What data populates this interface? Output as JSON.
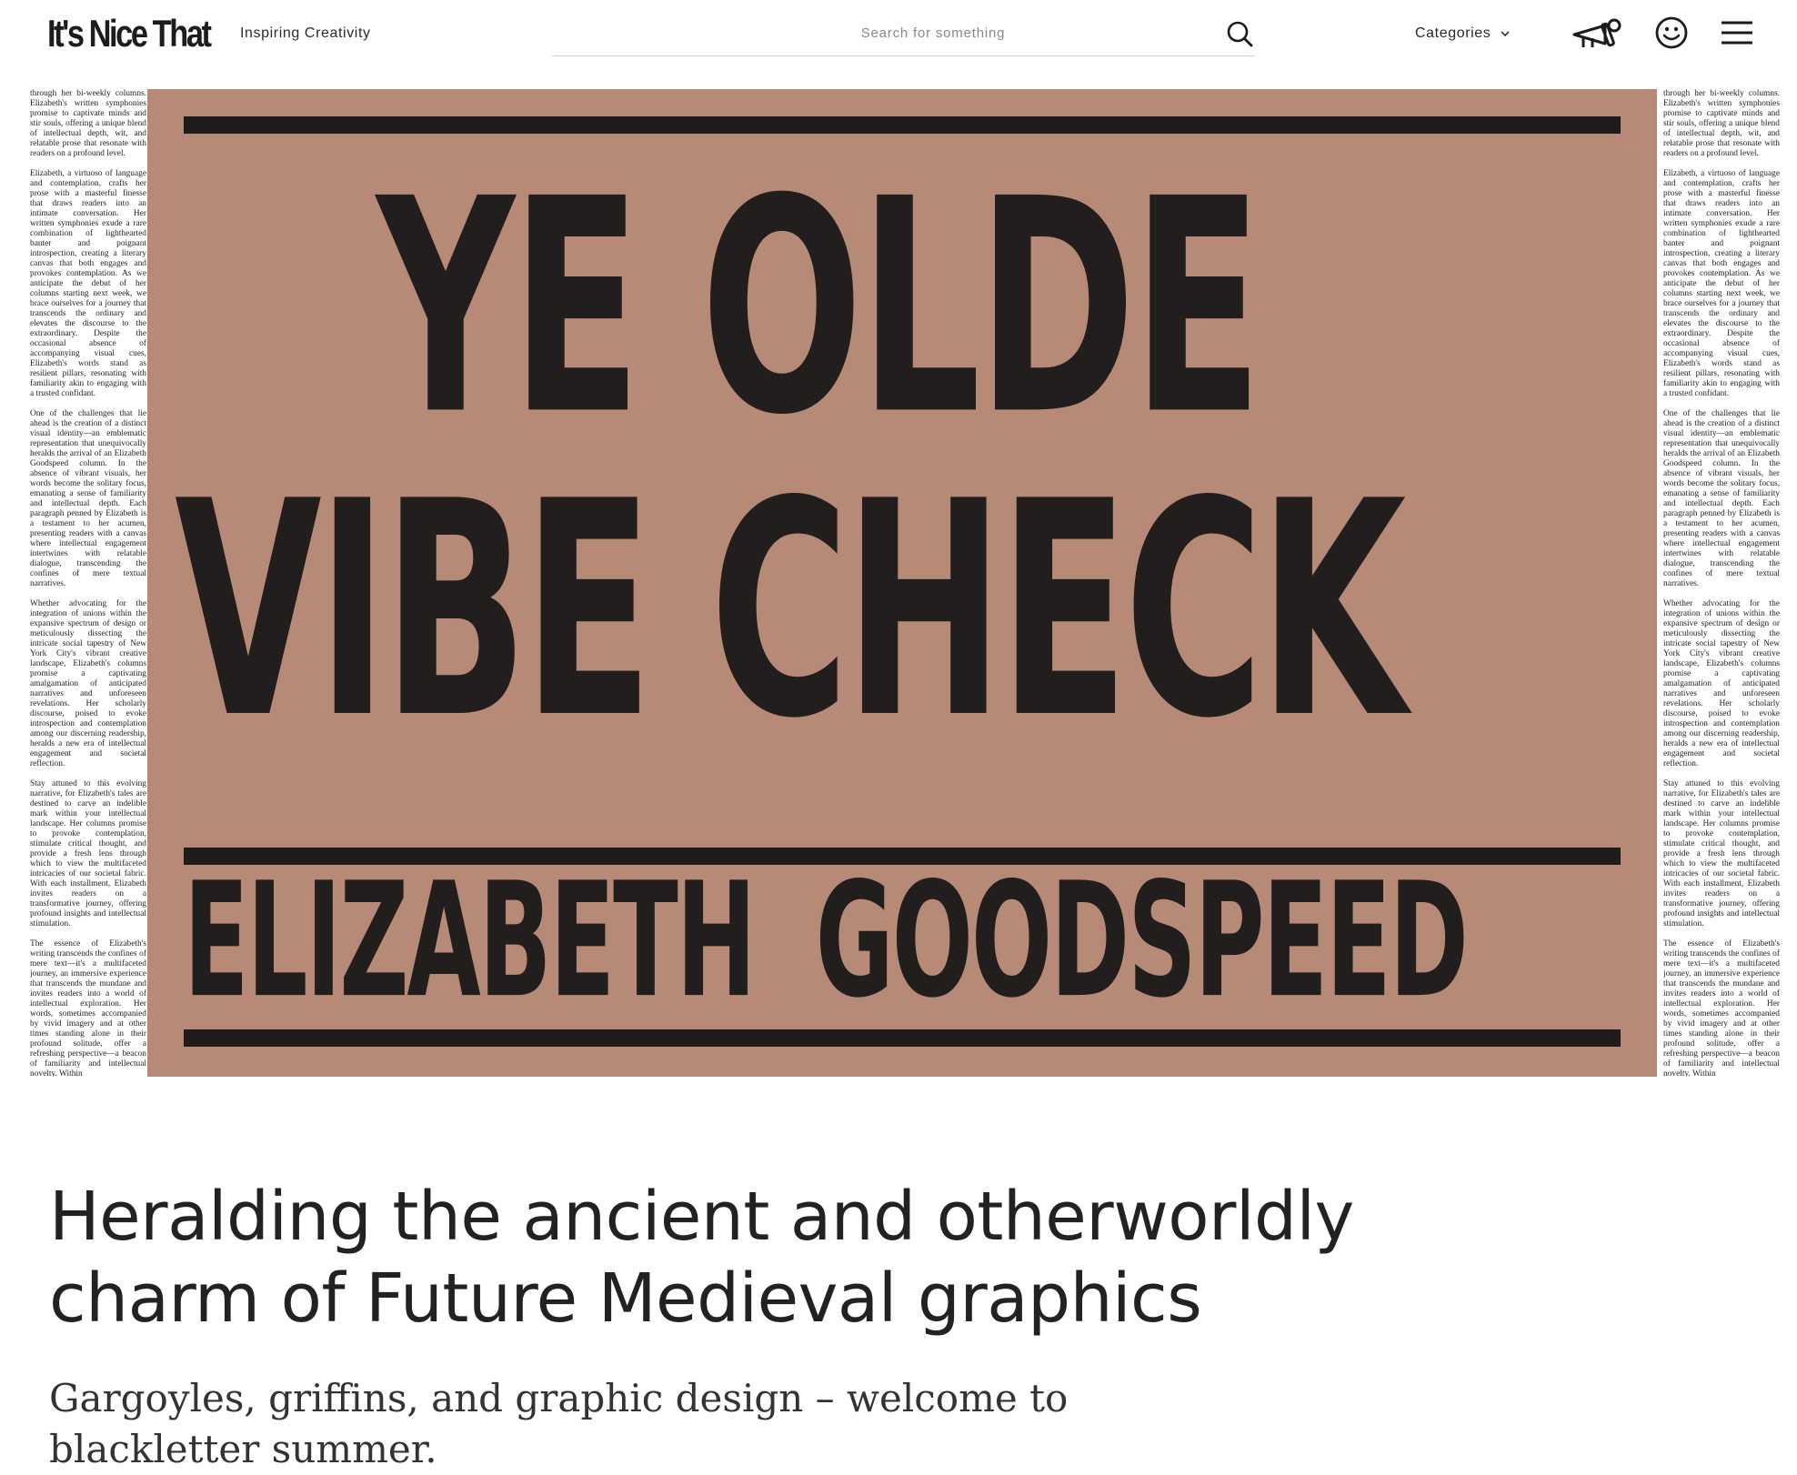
{
  "header": {
    "logo_text": "It's Nice That",
    "tagline": "Inspiring Creativity",
    "search_placeholder": "Search for something",
    "categories_label": "Categories",
    "icons": [
      "search-icon",
      "chevron-down-icon",
      "megaphone-icon",
      "smiley-icon",
      "hamburger-menu-icon"
    ]
  },
  "hero": {
    "poster": {
      "line1": "YE OLDE",
      "line2": "VIBE CHECK",
      "line3_a": "ELIZABETH",
      "line3_b": "GOODSPEED",
      "background_color": "#b68a77",
      "ink_color": "#231e1e"
    },
    "side_text": {
      "p1": "through her bi-weekly columns. Elizabeth's written symphonies promise to captivate minds and stir souls, offering a unique blend of intellectual depth, wit, and relatable prose that resonate with readers on a profound level.",
      "p2": "Elizabeth, a virtuoso of language and contemplation, crafts her prose with a masterful finesse that draws readers into an intimate conversation. Her written symphonies exude a rare combination of lighthearted banter and poignant introspection, creating a literary canvas that both engages and provokes contemplation. As we anticipate the debut of her columns starting next week, we brace ourselves for a journey that transcends the ordinary and elevates the discourse to the extraordinary. Despite the occasional absence of accompanying visual cues, Elizabeth's words stand as resilient pillars, resonating with familiarity akin to engaging with a trusted confidant.",
      "p3": "One of the challenges that lie ahead is the creation of a distinct visual identity—an emblematic representation that unequivocally heralds the arrival of an Elizabeth Goodspeed column. In the absence of vibrant visuals, her words become the solitary focus, emanating a sense of familiarity and intellectual depth. Each paragraph penned by Elizabeth is a testament to her acumen, presenting readers with a canvas where intellectual engagement intertwines with relatable dialogue, transcending the confines of mere textual narratives.",
      "p4": "Whether advocating for the integration of unions within the expansive spectrum of design or meticulously dissecting the intricate social tapestry of New York City's vibrant creative landscape, Elizabeth's columns promise a captivating amalgamation of anticipated narratives and unforeseen revelations. Her scholarly discourse, poised to evoke introspection and contemplation among our discerning readership, heralds a new era of intellectual engagement and societal reflection.",
      "p5": "Stay attuned to this evolving narrative, for Elizabeth's tales are destined to carve an indelible mark within your intellectual landscape. Her columns promise to provoke contemplation, stimulate critical thought, and provide a fresh lens through which to view the multifaceted intricacies of our societal fabric. With each installment, Elizabeth invites readers on a transformative journey, offering profound insights and intellectual stimulation.",
      "p6": "The essence of Elizabeth's writing transcends the confines of mere text—it's a multifaceted journey, an immersive experience that transcends the mundane and invites readers into a world of intellectual exploration. Her words, sometimes accompanied by vivid imagery and at other times standing alone in their profound solitude, offer a refreshing perspective—a beacon of familiarity and intellectual novelty. Within"
    }
  },
  "article": {
    "headline": "Heralding the ancient and otherworldly charm of Future Medieval graphics",
    "standfirst": "Gargoyles, griffins, and graphic design – welcome to blackletter summer."
  }
}
